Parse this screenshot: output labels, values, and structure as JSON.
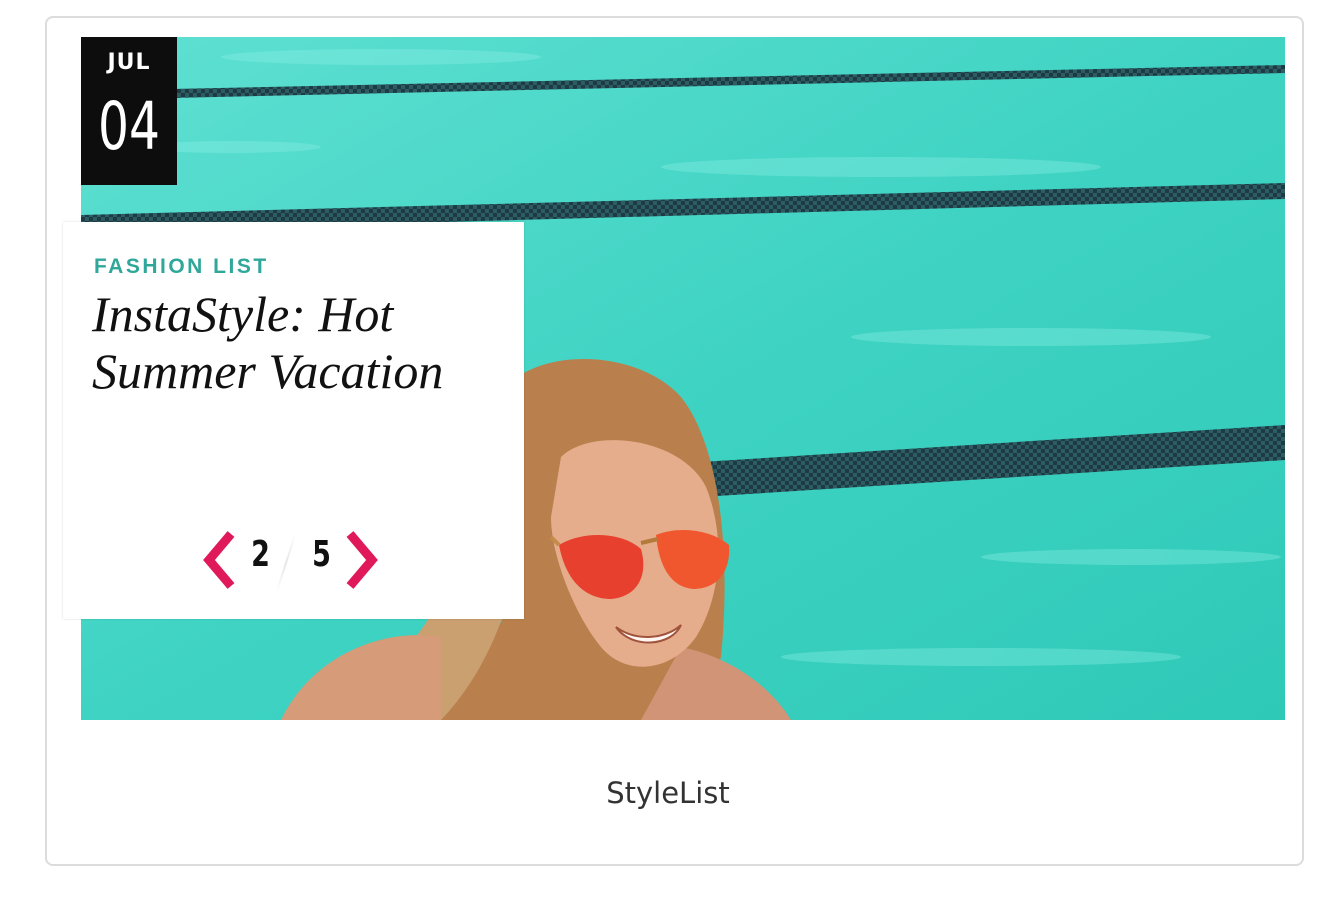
{
  "slide": {
    "date_month": "JUL",
    "date_day": "04",
    "category": "FASHION LIST",
    "headline": "InstaStyle: Hot Summer Vacation",
    "pager_current": "2",
    "pager_total": "5",
    "prev_icon": "chevron-left-icon",
    "next_icon": "chevron-right-icon"
  },
  "caption": "StyleList",
  "colors": {
    "accent_teal": "#2fa79a",
    "arrow_pink": "#e0195a",
    "badge_black": "#0d0d0d",
    "pool_water": "#3fd3c3"
  }
}
